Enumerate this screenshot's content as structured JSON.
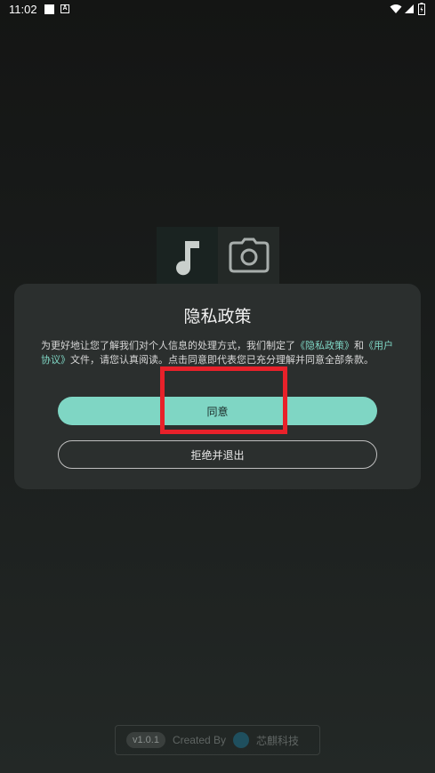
{
  "status_bar": {
    "time": "11:02",
    "badge_letter": "A",
    "icons": [
      "wifi-icon",
      "signal-icon",
      "battery-icon"
    ]
  },
  "background": {
    "icons": [
      "music-note-icon",
      "camera-icon"
    ]
  },
  "dialog": {
    "title": "隐私政策",
    "body_part1": "为更好地让您了解我们对个人信息的处理方式，我们制定了",
    "privacy_link": "《隐私政策》",
    "body_and": "和",
    "user_agreement_link": "《用户协议》",
    "body_part2": "文件，请您认真阅读。点击同意即代表您已充分理解并同意全部条款。",
    "agree_label": "同意",
    "refuse_label": "拒绝并退出"
  },
  "footer": {
    "version": "v1.0.1",
    "created_by": "Created By",
    "company": "芯麒科技"
  },
  "colors": {
    "accent": "#7fd6c4",
    "dialog_bg": "#2b2f2e",
    "highlight": "#e8212a"
  }
}
